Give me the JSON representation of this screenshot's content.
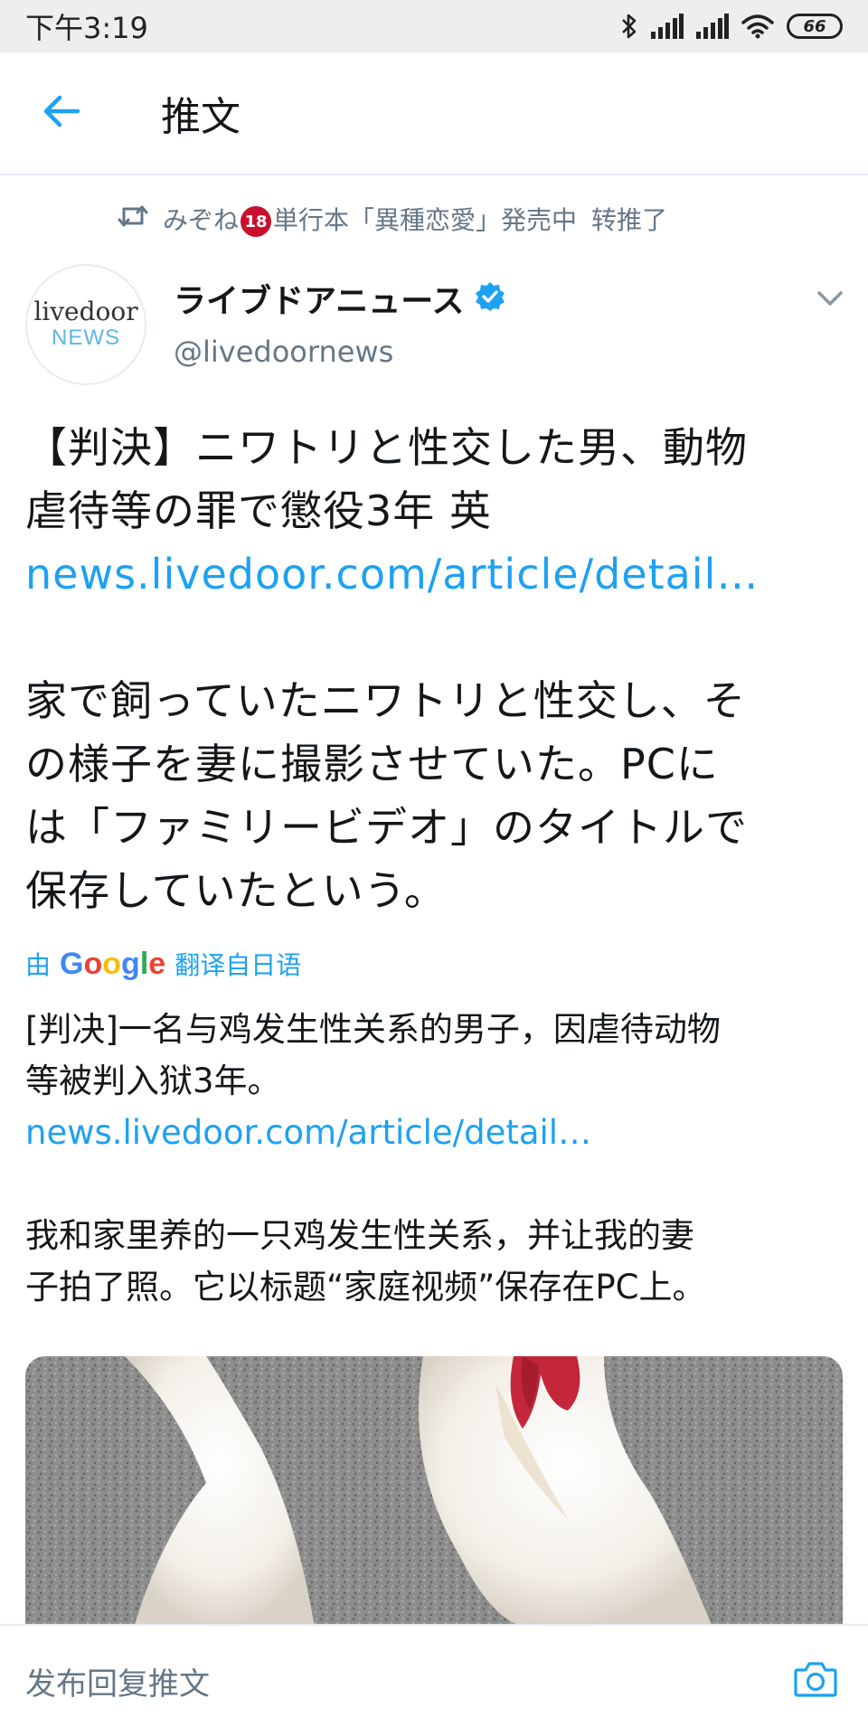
{
  "status_bar": {
    "time": "下午3:19",
    "battery_level": "66",
    "icons": [
      "bluetooth-icon",
      "signal-icon",
      "signal-icon",
      "wifi-icon",
      "battery-icon"
    ]
  },
  "appbar": {
    "back_icon": "arrow-left-icon",
    "title": "推文"
  },
  "retweet_context": {
    "icon": "retweet-icon",
    "user_before_badge": "みぞね",
    "badge": "18",
    "user_after_badge": "単行本「異種恋愛」発売中",
    "action": "转推了"
  },
  "author": {
    "avatar_line1": "livedoor",
    "avatar_line2": "NEWS",
    "name": "ライブドアニュース",
    "verified_icon": "verified-badge-icon",
    "handle": "@livedoornews",
    "caret_icon": "chevron-down-icon"
  },
  "tweet": {
    "line1": "【判決】ニワトリと性交した男、動物",
    "line2": "虐待等の罪で懲役3年 英",
    "link": "news.livedoor.com/article/detail…",
    "para2_line1": "家で飼っていたニワトリと性交し、そ",
    "para2_line2": "の様子を妻に撮影させていた。PCに",
    "para2_line3": "は「ファミリービデオ」のタイトルで",
    "para2_line4": "保存していたという。"
  },
  "translation": {
    "prefix": "由",
    "google_letters": [
      "G",
      "o",
      "o",
      "g",
      "l",
      "e"
    ],
    "suffix": "翻译自日语",
    "line1": "[判决]一名与鸡发生性关系的男子，因虐待动物",
    "line2": "等被判入狱3年。",
    "link": "news.livedoor.com/article/detail…",
    "para2_line1": "我和家里养的一只鸡发生性关系，并让我的妻",
    "para2_line2": "子拍了照。它以标题“家庭视频”保存在PC上。"
  },
  "colors": {
    "accent": "#1da1f2",
    "secondary_text": "#657786",
    "google": [
      "#4285F4",
      "#EA4335",
      "#FBBC05",
      "#4285F4",
      "#34A853",
      "#EA4335"
    ]
  },
  "media": {
    "subject": "white rooster on gravel"
  },
  "reply_bar": {
    "placeholder": "发布回复推文",
    "camera_icon": "camera-icon"
  }
}
